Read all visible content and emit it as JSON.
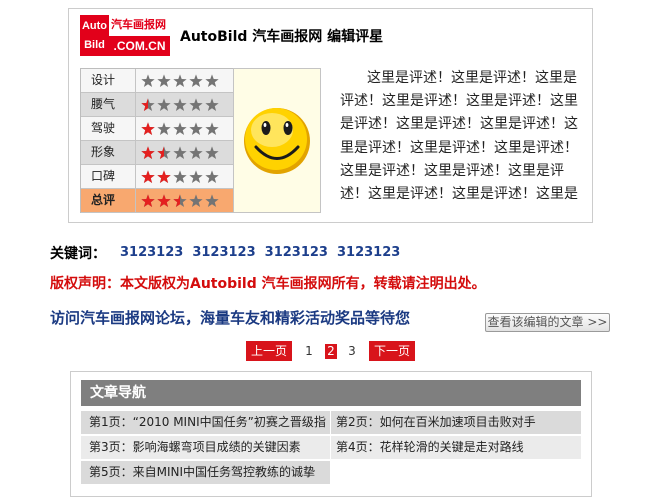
{
  "logo": {
    "auto": "Auto",
    "bild": "Bild",
    "cn_name": "汽车画报网",
    "domain": ".COM.CN"
  },
  "header": {
    "title": "AutoBild 汽车画报网 编辑评星"
  },
  "ratings": {
    "max_stars": 5,
    "rows": [
      {
        "label": "设计",
        "stars": 0
      },
      {
        "label": "腰气",
        "stars": 0.5
      },
      {
        "label": "驾驶",
        "stars": 1
      },
      {
        "label": "形象",
        "stars": 1.5
      },
      {
        "label": "口碑",
        "stars": 2
      },
      {
        "label": "总评",
        "stars": 2.5
      }
    ]
  },
  "smiley_icon": "smiley-face-icon",
  "review": {
    "lines": [
      "这里是评述！这里是评述！这里是",
      "评述！这里是评述！这里是评述！这里",
      "是评述！这里是评述！这里是评述！这",
      "里是评述！这里是评述！这里是评述！",
      "这里是评述！这里是评述！这里是评",
      "述！这里是评述！这里是评述！这里是"
    ]
  },
  "keywords": {
    "label": "关键词：",
    "items": [
      "3123123",
      "3123123",
      "3123123",
      "3123123"
    ]
  },
  "copyright": "版权声明：本文版权为Autobild 汽车画报网所有，转载请注明出处。",
  "forum_link": "访问汽车画报网论坛，海量车友和精彩活动奖品等待您",
  "editor_articles_button": "查看该编辑的文章 >>",
  "pagination": {
    "prev": "上一页",
    "next": "下一页",
    "pages": [
      "1",
      "2",
      "3"
    ],
    "current": "2"
  },
  "article_nav": {
    "title": "文章导航",
    "items": [
      "第1页：“2010 MINI中国任务”初赛之晋级指",
      "第2页：如何在百米加速项目击败对手",
      "第3页：影响海螺弯项目成绩的关键因素",
      "第4页：花样轮滑的关键是走对路线",
      "第5页：来自MINI中国任务驾控教练的诚挚"
    ]
  },
  "colors": {
    "brand_red": "#e2001a",
    "star_filled": "#e5201f",
    "star_empty": "#747474",
    "keyword_blue": "#1d3f8c",
    "copyright_red": "#d40c0c",
    "total_row_highlight": "#f8a86f",
    "nav_header": "#7f7f7f"
  }
}
